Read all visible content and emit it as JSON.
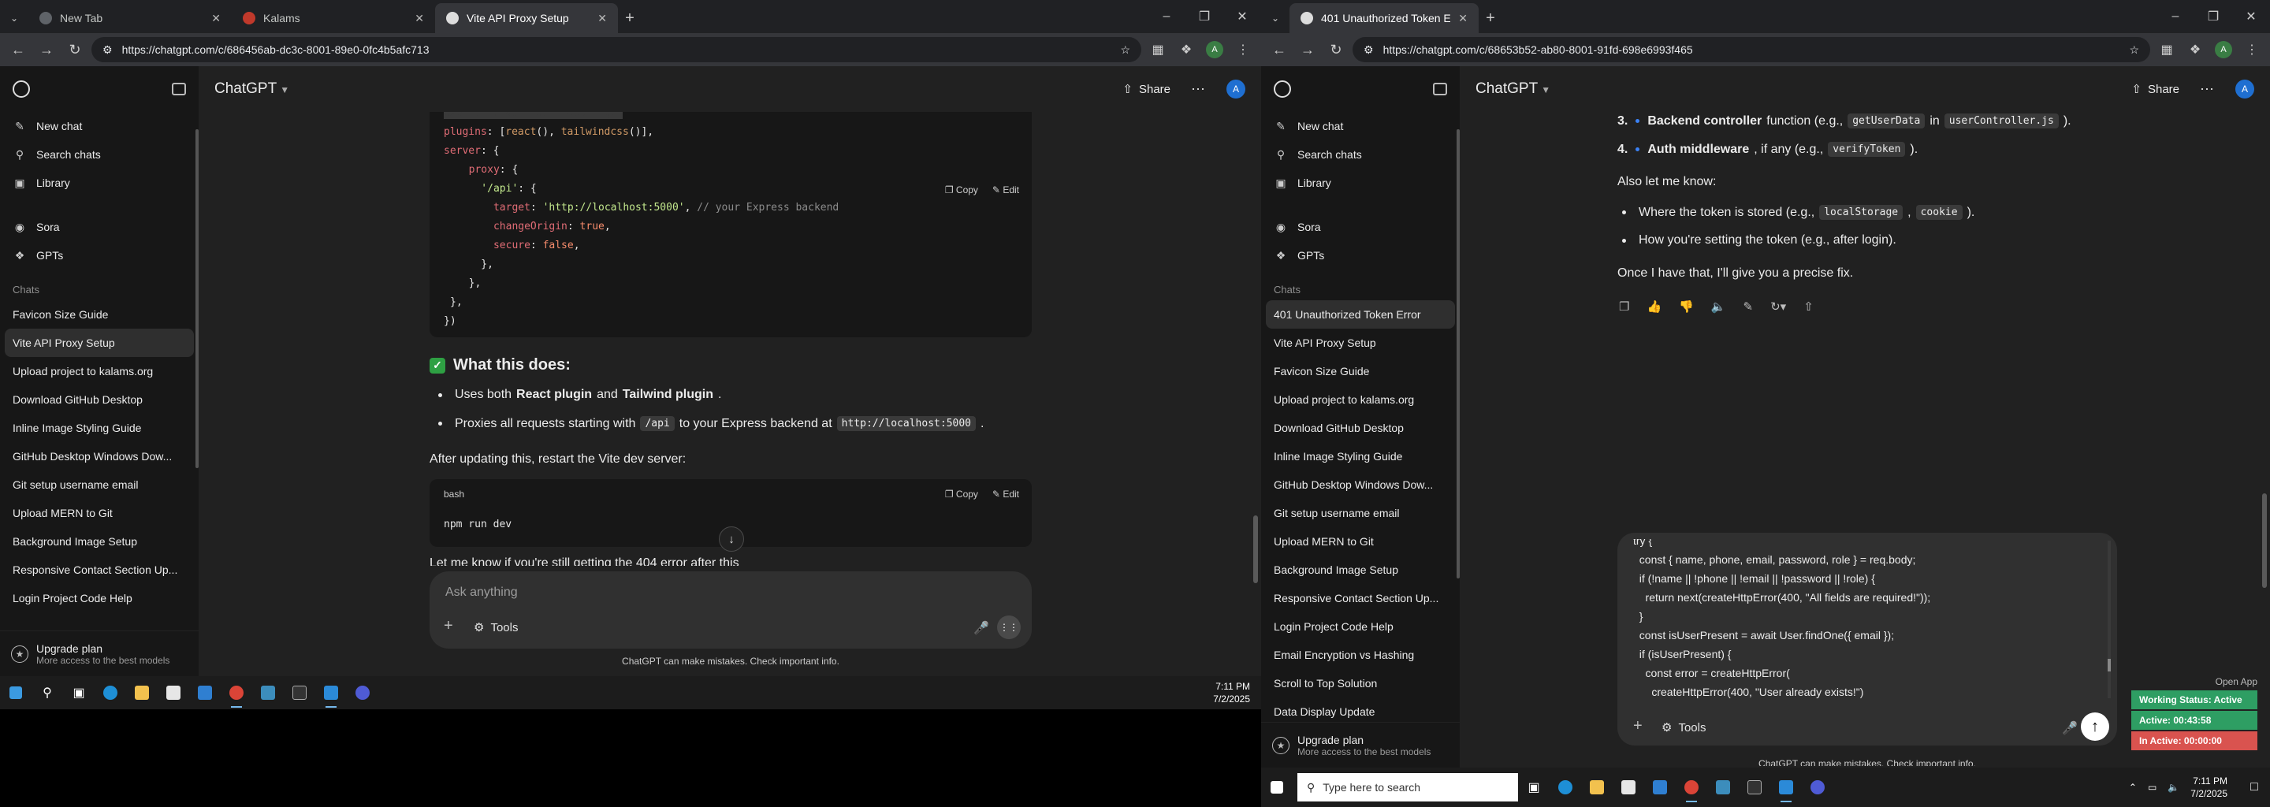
{
  "left": {
    "tabs": [
      {
        "label": "New Tab",
        "color": "#5f6368",
        "active": false
      },
      {
        "label": "Kalams",
        "color": "#c0392b",
        "active": false
      },
      {
        "label": "Vite API Proxy Setup",
        "color": "#dddddd",
        "active": true
      }
    ],
    "url": "https://chatgpt.com/c/686456ab-dc3c-8001-89e0-0fc4b5afc713",
    "sidebar": {
      "nav": [
        {
          "label": "New chat",
          "icon": "new-chat-icon"
        },
        {
          "label": "Search chats",
          "icon": "search-icon"
        },
        {
          "label": "Library",
          "icon": "library-icon"
        }
      ],
      "apps": [
        {
          "label": "Sora",
          "icon": "sora-icon"
        },
        {
          "label": "GPTs",
          "icon": "gpts-icon"
        }
      ],
      "chats_heading": "Chats",
      "chats": [
        "Favicon Size Guide",
        "Vite API Proxy Setup",
        "Upload project to kalams.org",
        "Download GitHub Desktop",
        "Inline Image Styling Guide",
        "GitHub Desktop Windows Dow...",
        "Git setup username email",
        "Upload MERN to Git",
        "Background Image Setup",
        "Responsive Contact Section Up...",
        "Login Project Code Help"
      ],
      "active_chat": 1,
      "upgrade_title": "Upgrade plan",
      "upgrade_sub": "More access to the best models"
    },
    "header": {
      "model": "ChatGPT",
      "share": "Share",
      "avatar": "A"
    },
    "code1": {
      "copy": "Copy",
      "edit": "Edit",
      "lines": [
        [
          {
            "t": "plugins",
            "c": "tk-key"
          },
          {
            "t": ": [",
            "c": "tk-punc"
          },
          {
            "t": "react",
            "c": "tk-fn"
          },
          {
            "t": "(), ",
            "c": "tk-punc"
          },
          {
            "t": "tailwindcss",
            "c": "tk-fn"
          },
          {
            "t": "()],",
            "c": "tk-punc"
          }
        ],
        [
          {
            "t": "server",
            "c": "tk-key"
          },
          {
            "t": ": {",
            "c": "tk-punc"
          }
        ],
        [
          {
            "t": "  proxy",
            "c": "tk-key"
          },
          {
            "t": ": {",
            "c": "tk-punc"
          }
        ],
        [
          {
            "t": "    '/api'",
            "c": "tk-str"
          },
          {
            "t": ": {",
            "c": "tk-punc"
          }
        ],
        [
          {
            "t": "      target",
            "c": "tk-key"
          },
          {
            "t": ": ",
            "c": "tk-punc"
          },
          {
            "t": "'http://localhost:5000'",
            "c": "tk-str"
          },
          {
            "t": ", ",
            "c": "tk-punc"
          },
          {
            "t": "// your Express backend",
            "c": "tk-cmt"
          }
        ],
        [
          {
            "t": "      changeOrigin",
            "c": "tk-key"
          },
          {
            "t": ": ",
            "c": "tk-punc"
          },
          {
            "t": "true",
            "c": "tk-bool"
          },
          {
            "t": ",",
            "c": "tk-punc"
          }
        ],
        [
          {
            "t": "      secure",
            "c": "tk-key"
          },
          {
            "t": ": ",
            "c": "tk-punc"
          },
          {
            "t": "false",
            "c": "tk-bool"
          },
          {
            "t": ",",
            "c": "tk-punc"
          }
        ],
        [
          {
            "t": "    },",
            "c": "tk-punc"
          }
        ],
        [
          {
            "t": "  },",
            "c": "tk-punc"
          }
        ],
        [
          {
            "t": "},",
            "c": "tk-punc"
          }
        ],
        [
          {
            "t": "})",
            "c": "tk-punc"
          }
        ]
      ]
    },
    "what_heading": "What this does:",
    "bullet1": {
      "pre": "Uses both ",
      "b1": "React plugin",
      "mid": " and ",
      "b2": "Tailwind plugin",
      "post": "."
    },
    "bullet2": {
      "pre": "Proxies all requests starting with ",
      "code1": "/api",
      "mid": " to your Express backend at ",
      "code2": "http://localhost:5000",
      "post": "."
    },
    "after_para": "After updating this, restart the Vite dev server:",
    "code2": {
      "lang": "bash",
      "copy": "Copy",
      "edit": "Edit",
      "line": "npm run dev"
    },
    "cut_para": "Let me know if you're still getting the 404 error after this",
    "composer": {
      "placeholder": "Ask anything",
      "tools": "Tools"
    },
    "disclaimer": "ChatGPT can make mistakes. Check important info.",
    "taskbar": {
      "time": "7:11 PM",
      "date": "7/2/2025"
    }
  },
  "right": {
    "tabs": [
      {
        "label": "401 Unauthorized Token Error",
        "color": "#dddddd",
        "active": true
      }
    ],
    "url": "https://chatgpt.com/c/68653b52-ab80-8001-91fd-698e6993f465",
    "sidebar": {
      "nav": [
        {
          "label": "New chat",
          "icon": "new-chat-icon"
        },
        {
          "label": "Search chats",
          "icon": "search-icon"
        },
        {
          "label": "Library",
          "icon": "library-icon"
        }
      ],
      "apps": [
        {
          "label": "Sora",
          "icon": "sora-icon"
        },
        {
          "label": "GPTs",
          "icon": "gpts-icon"
        }
      ],
      "chats_heading": "Chats",
      "chats": [
        "401 Unauthorized Token Error",
        "Vite API Proxy Setup",
        "Favicon Size Guide",
        "Upload project to kalams.org",
        "Download GitHub Desktop",
        "Inline Image Styling Guide",
        "GitHub Desktop Windows Dow...",
        "Git setup username email",
        "Upload MERN to Git",
        "Background Image Setup",
        "Responsive Contact Section Up...",
        "Login Project Code Help",
        "Email Encryption vs Hashing",
        "Scroll to Top Solution",
        "Data Display Update"
      ],
      "active_chat": 0,
      "upgrade_title": "Upgrade plan",
      "upgrade_sub": "More access to the best models"
    },
    "header": {
      "model": "ChatGPT",
      "share": "Share",
      "avatar": "A"
    },
    "list3": {
      "num": "3.",
      "b": "Backend controller",
      "pre": " function (e.g., ",
      "code1": "getUserData",
      "mid": " in ",
      "code2": "userController.js",
      "post": ")."
    },
    "list4": {
      "num": "4.",
      "b": "Auth middleware",
      "pre": ", if any (e.g., ",
      "code1": "verifyToken",
      "post": ")."
    },
    "also": "Also let me know:",
    "b1": {
      "pre": "Where the token is stored (e.g., ",
      "code1": "localStorage",
      "mid": ", ",
      "code2": "cookie",
      "post": ")."
    },
    "b2": "How you're setting the token (e.g., after login).",
    "once": "Once I have that, I'll give you a precise fix.",
    "editor_lines": [
      "try {",
      "  const { name, phone, email, password, role } = req.body;",
      "  if (!name || !phone || !email || !password || !role) {",
      "    return next(createHttpError(400, \"All fields are required!\"));",
      "  }",
      "  const isUserPresent = await User.findOne({ email });",
      "  if (isUserPresent) {",
      "    const error = createHttpError(",
      "      createHttpError(400, \"User already exists!\")",
      "    );"
    ],
    "composer": {
      "tools": "Tools"
    },
    "disclaimer": "ChatGPT can make mistakes. Check important info.",
    "status": {
      "open_app": "Open App",
      "working": "Working Status: Active",
      "active": "Active: 00:43:58",
      "inactive": "In Active: 00:00:00",
      "working_color": "#2e9e63",
      "active_color": "#2e9e63",
      "inactive_color": "#d9534f"
    },
    "taskbar": {
      "search": "Type here to search",
      "time": "7:11 PM",
      "date": "7/2/2025"
    }
  }
}
